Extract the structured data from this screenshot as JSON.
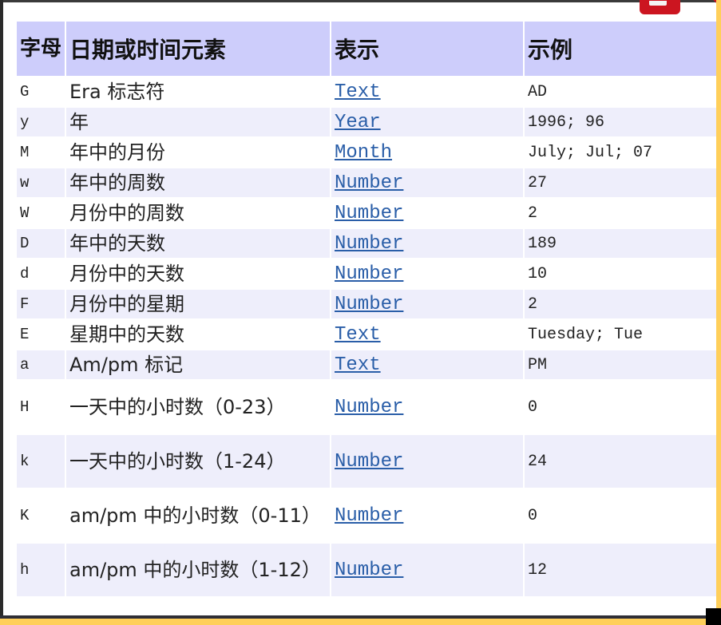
{
  "table": {
    "headers": [
      "字母",
      "日期或时间元素",
      "表示",
      "示例"
    ],
    "header_bg": "#cdcdfb",
    "alt_row_bg": "#eeeefb",
    "link_color": "#2a5ea8",
    "rows": [
      {
        "letter": "G",
        "element": "Era 标志符",
        "presentation": "Text",
        "example": "AD"
      },
      {
        "letter": "y",
        "element": "年",
        "presentation": "Year",
        "example": "1996; 96"
      },
      {
        "letter": "M",
        "element": "年中的月份",
        "presentation": "Month",
        "example": "July; Jul; 07"
      },
      {
        "letter": "w",
        "element": "年中的周数",
        "presentation": "Number",
        "example": "27"
      },
      {
        "letter": "W",
        "element": "月份中的周数",
        "presentation": "Number",
        "example": "2"
      },
      {
        "letter": "D",
        "element": "年中的天数",
        "presentation": "Number",
        "example": "189"
      },
      {
        "letter": "d",
        "element": "月份中的天数",
        "presentation": "Number",
        "example": "10"
      },
      {
        "letter": "F",
        "element": "月份中的星期",
        "presentation": "Number",
        "example": "2"
      },
      {
        "letter": "E",
        "element": "星期中的天数",
        "presentation": "Text",
        "example": "Tuesday; Tue"
      },
      {
        "letter": "a",
        "element": "Am/pm 标记",
        "presentation": "Text",
        "example": "PM"
      },
      {
        "letter": "H",
        "element": "一天中的小时数（0-23）",
        "presentation": "Number",
        "example": "0"
      },
      {
        "letter": "k",
        "element": "一天中的小时数（1-24）",
        "presentation": "Number",
        "example": "24"
      },
      {
        "letter": "K",
        "element": "am/pm 中的小时数（0-11）",
        "presentation": "Number",
        "example": "0"
      },
      {
        "letter": "h",
        "element": "am/pm 中的小时数（1-12）",
        "presentation": "Number",
        "example": "12"
      }
    ]
  },
  "frame": {
    "accent_color": "#ffcf5a",
    "badge_color": "#cc1520"
  }
}
